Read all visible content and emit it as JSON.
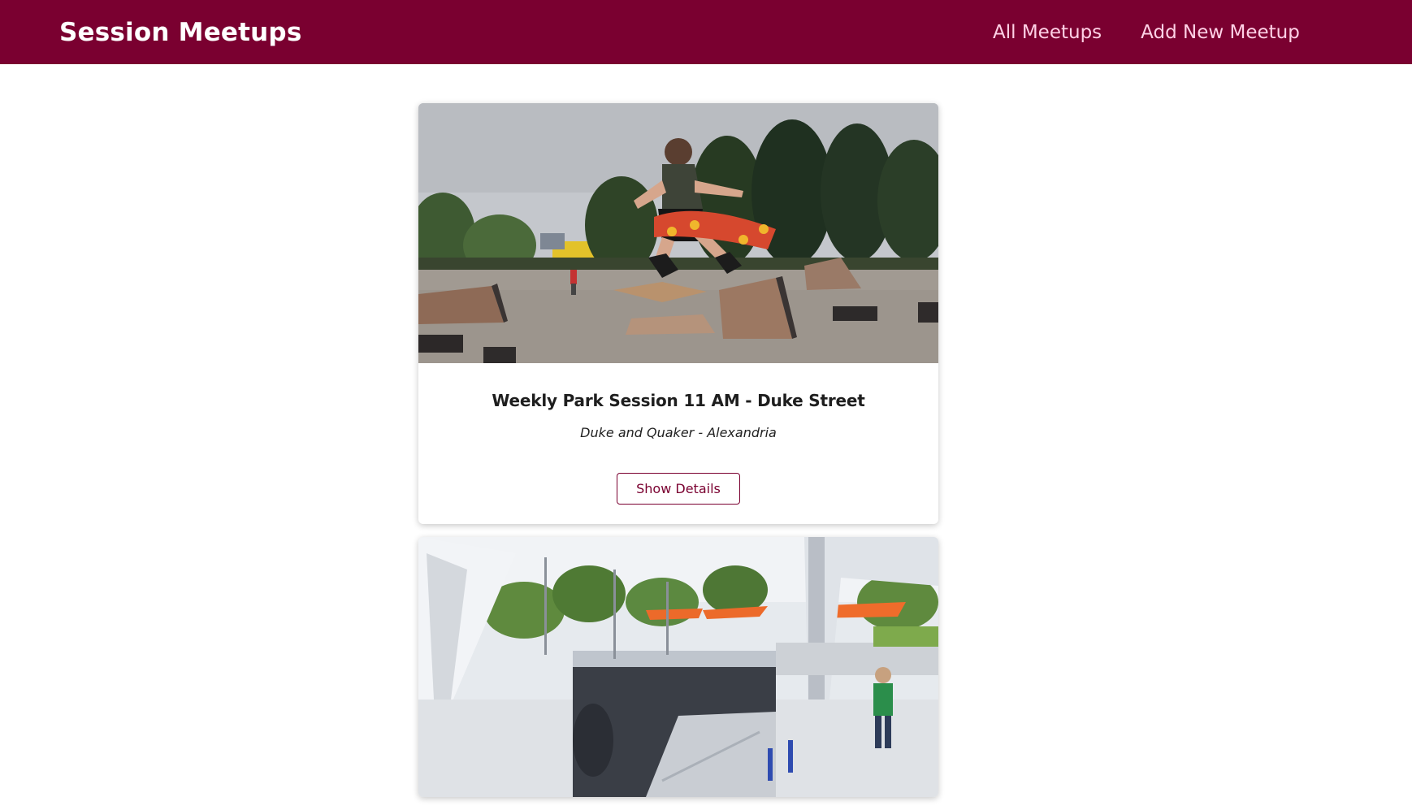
{
  "app": {
    "title": "Session Meetups"
  },
  "nav": {
    "items": [
      {
        "label": "All Meetups"
      },
      {
        "label": "Add New Meetup"
      }
    ]
  },
  "colors": {
    "brand": "#7a0030",
    "nav_text": "#ffd1e6",
    "background": "#ffffff"
  },
  "meetups": [
    {
      "title": "Weekly Park Session 11 AM - Duke Street",
      "address": "Duke and Quaker - Alexandria",
      "button_label": "Show Details"
    },
    {
      "title": "",
      "address": "",
      "button_label": ""
    }
  ]
}
